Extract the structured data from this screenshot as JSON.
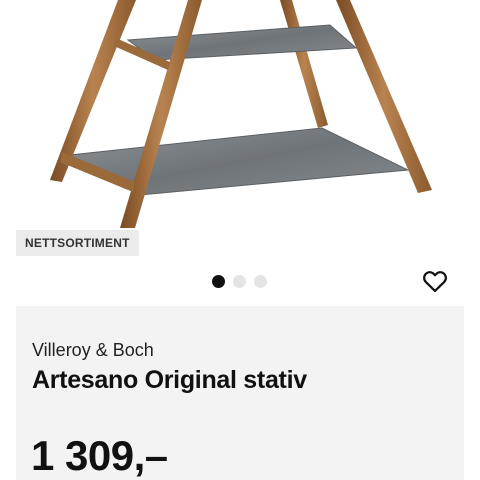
{
  "product": {
    "badge": "NETTSORTIMENT",
    "brand": "Villeroy & Boch",
    "title": "Artesano Original stativ",
    "price": "1 309,–",
    "image_icon": "product-photo-stand",
    "favorite_icon": "heart-outline-icon"
  },
  "carousel": {
    "total": 3,
    "active_index": 0
  },
  "colors": {
    "card_background": "#f4f3f3",
    "badge_background": "#ebebeb",
    "dot_active": "#111111",
    "dot_inactive": "#e4e4e4"
  }
}
